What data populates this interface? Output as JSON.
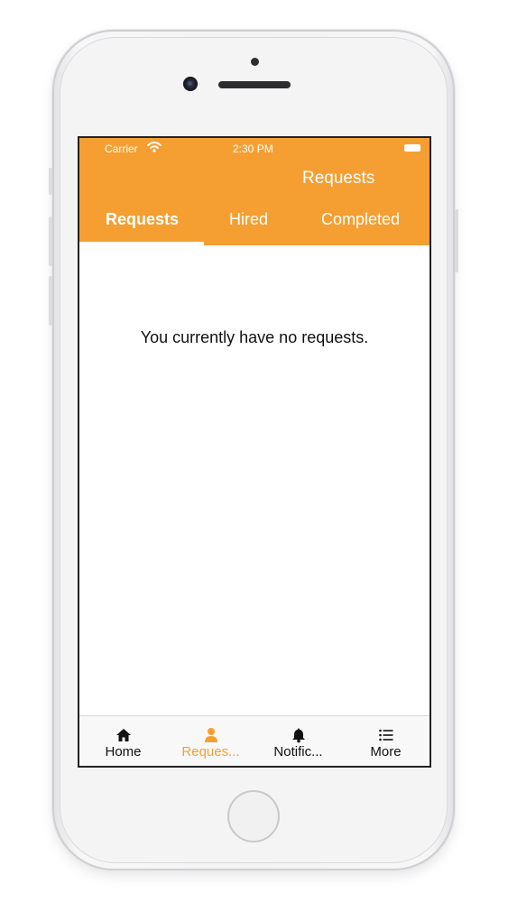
{
  "status_bar": {
    "carrier": "Carrier",
    "time": "2:30 PM"
  },
  "nav": {
    "title": "Requests"
  },
  "tabs": [
    {
      "label": "Requests",
      "active": true
    },
    {
      "label": "Hired",
      "active": false
    },
    {
      "label": "Completed",
      "active": false
    }
  ],
  "content": {
    "empty_message": "You currently have no requests."
  },
  "tab_bar": [
    {
      "label": "Home",
      "icon": "home-icon",
      "active": false
    },
    {
      "label": "Reques...",
      "icon": "person-icon",
      "active": true
    },
    {
      "label": "Notific...",
      "icon": "bell-icon",
      "active": false
    },
    {
      "label": "More",
      "icon": "list-icon",
      "active": false
    }
  ],
  "colors": {
    "accent": "#f59f33",
    "header_text": "#ffffff",
    "tab_bar_bg": "#f8f8f8"
  }
}
